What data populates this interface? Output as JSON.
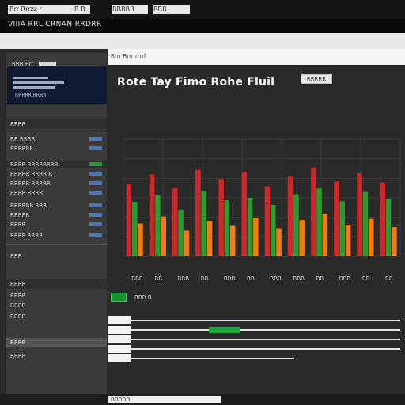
{
  "window": {
    "tabs": [
      {
        "label": "Rrr Rrrzz r"
      },
      {
        "label": "R R"
      },
      {
        "label": "RRRRR"
      },
      {
        "label": "RRR"
      }
    ]
  },
  "app": {
    "title": "VIIIA RRLICRNAN RRDRR"
  },
  "sidebar": {
    "top_label": "RRR Rrr",
    "card": {
      "text": "RRRRR RRRR"
    },
    "sections": [
      {
        "label": "RRRR"
      },
      {
        "label": "RRRR"
      },
      {
        "label": "RRRR"
      }
    ],
    "rows": [
      {
        "label": "RR RRRR"
      },
      {
        "label": "RRRRRR"
      },
      {
        "label": "RRRR RRRRRRRR"
      },
      {
        "label": "RRRRR RRRR R"
      },
      {
        "label": "RRRRR RRRRR"
      },
      {
        "label": "RRRR RRRR"
      },
      {
        "label": "RRRRRR RRR"
      },
      {
        "label": "RRRRR"
      },
      {
        "label": "RRRR"
      },
      {
        "label": "RRRR RRRR"
      },
      {
        "label": "RRR"
      },
      {
        "label": "RRRR"
      },
      {
        "label": "RRRR"
      },
      {
        "label": "RRRR"
      },
      {
        "label": "RRRR"
      }
    ]
  },
  "main": {
    "header_label": "Rrrr Rrrr rrrrl",
    "chart_title": "Rote Tay Fimo Rohe Fluil",
    "chart_button": "RRRRR",
    "lower_small": "RRR R"
  },
  "chart_data": {
    "type": "bar",
    "categories": [
      "RRR",
      "RR",
      "RRR",
      "RR",
      "RRR",
      "RR",
      "RRR",
      "RRR",
      "RR",
      "RRR",
      "RR",
      "RR"
    ],
    "series": [
      {
        "values": [
          0.62,
          0.7,
          0.58,
          0.74,
          0.66,
          0.72,
          0.6,
          0.68,
          0.76,
          0.64,
          0.71,
          0.63
        ]
      },
      {
        "values": [
          0.46,
          0.52,
          0.4,
          0.56,
          0.48,
          0.5,
          0.44,
          0.53,
          0.58,
          0.47,
          0.55,
          0.49
        ]
      },
      {
        "values": [
          0.28,
          0.34,
          0.22,
          0.3,
          0.26,
          0.33,
          0.24,
          0.31,
          0.36,
          0.27,
          0.32,
          0.25
        ]
      }
    ],
    "title": "Rote Tay Fimo Rohe Fluil",
    "ylim": [
      0,
      1
    ],
    "colors": [
      "#d62728",
      "#2ca02c",
      "#ff7f0e"
    ]
  },
  "footer": {
    "label": "RRRRR"
  },
  "colors": {
    "accent_green": "#1ea43a",
    "accent_blue": "#4a78b8",
    "sidebar_bg": "#3a3a3a",
    "main_bg": "#2a2a2a",
    "white": "#f5f5f5"
  }
}
